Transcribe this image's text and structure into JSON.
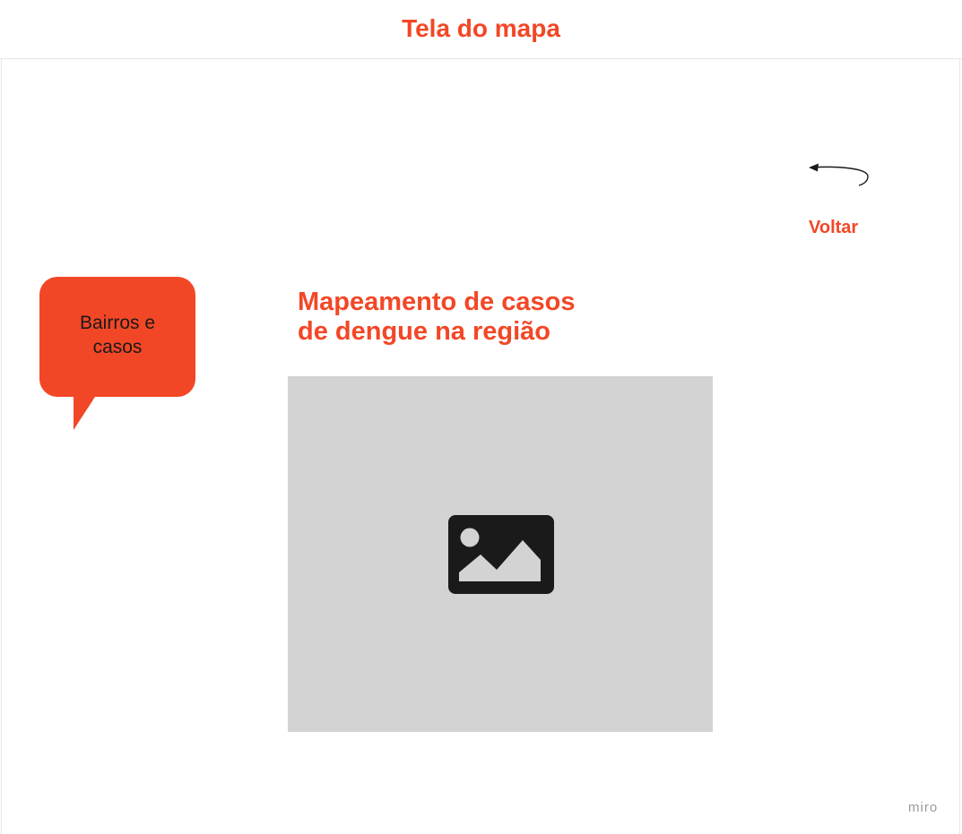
{
  "frame": {
    "title": "Tela do mapa"
  },
  "back": {
    "label": "Voltar",
    "icon": "curved-arrow-left-icon"
  },
  "callout": {
    "text": "Bairros e\ncasos",
    "color": "#f24726"
  },
  "map": {
    "heading": "Mapeamento de casos\nde dengue na região",
    "image_icon": "image-placeholder-icon",
    "placeholder_color": "#d3d3d3"
  },
  "watermark": {
    "text": "miro"
  },
  "colors": {
    "accent": "#f24726",
    "text_dark": "#1a1a1a"
  }
}
